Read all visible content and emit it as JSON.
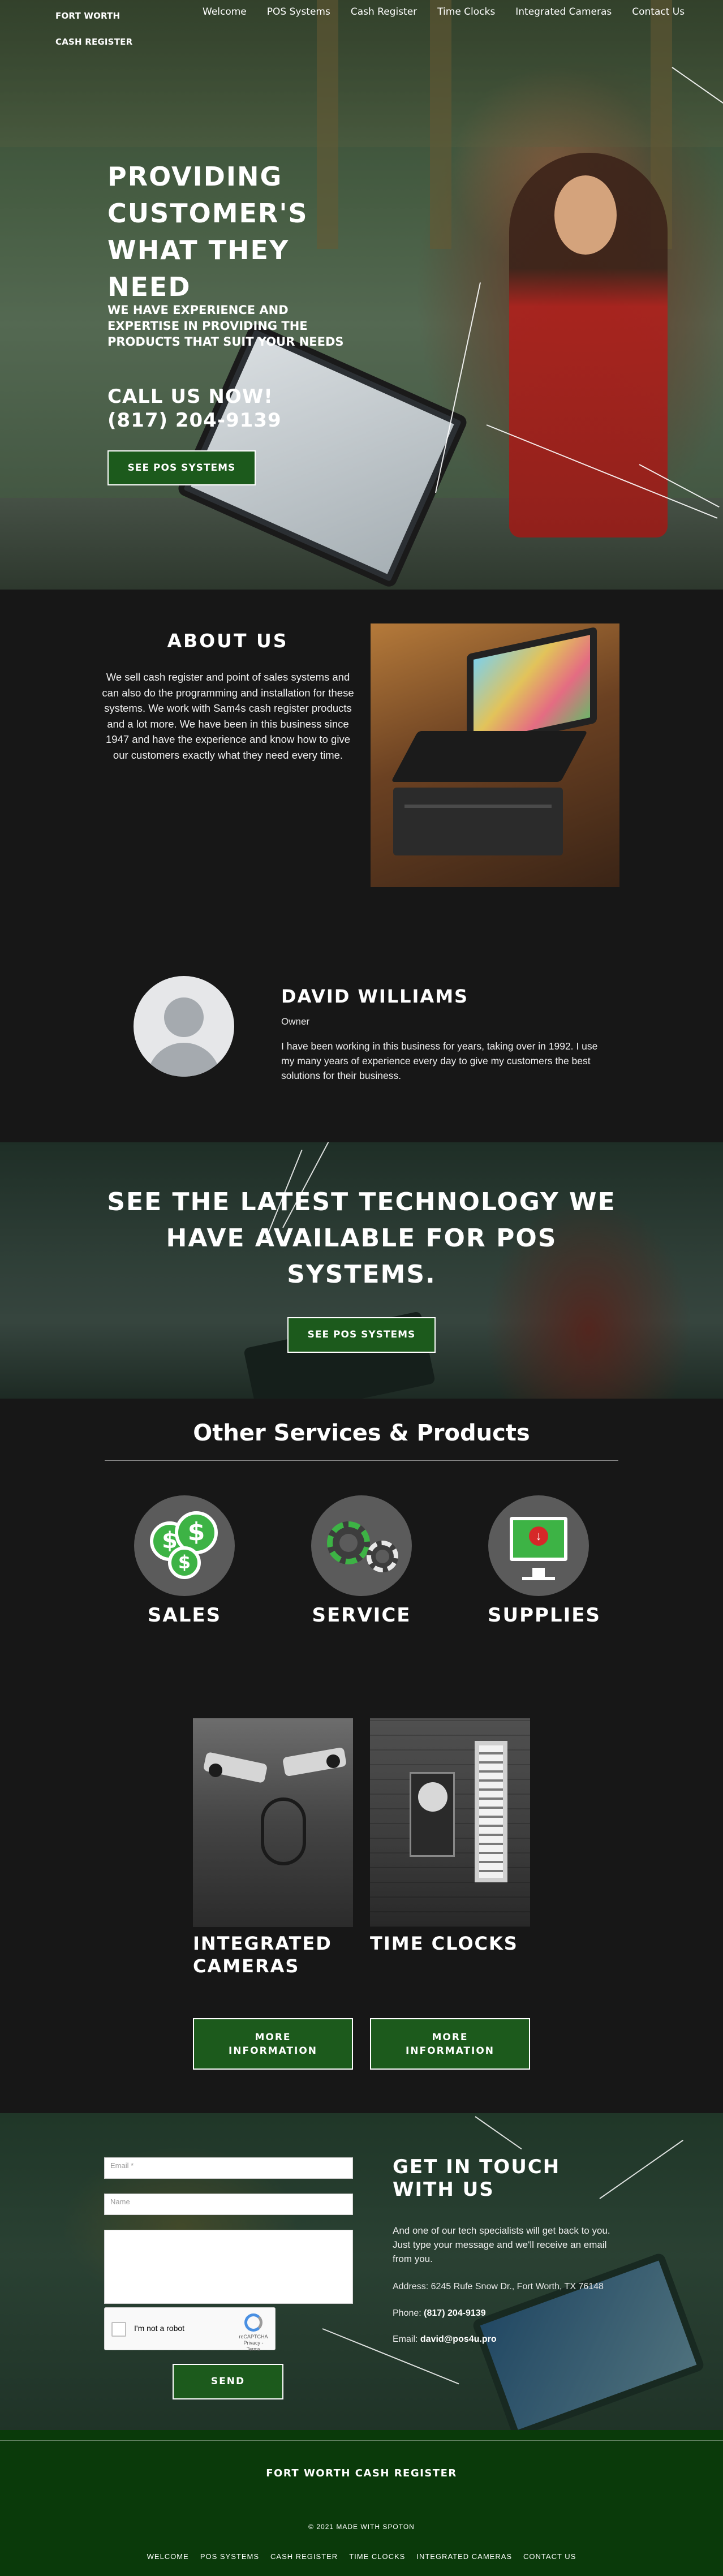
{
  "header": {
    "brand_line1": "FORT WORTH",
    "brand_line2": "CASH REGISTER",
    "nav": [
      "Welcome",
      "POS Systems",
      "Cash Register",
      "Time Clocks",
      "Integrated Cameras",
      "Contact Us"
    ]
  },
  "hero": {
    "title": "PROVIDING CUSTOMER'S WHAT THEY NEED",
    "subtitle": "WE HAVE EXPERIENCE AND EXPERTISE IN PROVIDING THE PRODUCTS THAT SUIT YOUR NEEDS",
    "call_label": "CALL US NOW!",
    "phone": "(817) 204-9139",
    "button": "SEE POS SYSTEMS"
  },
  "about": {
    "title": "ABOUT US",
    "text": "We sell cash register and point of sales systems and can also do the programming and installation for these systems. We work with Sam4s cash register products and a lot more. We have been in this business since 1947 and have the experience and know how to give our customers exactly what they need every time."
  },
  "owner": {
    "name": "DAVID WILLIAMS",
    "role": "Owner",
    "bio": "I have been working in this business for years, taking over in 1992. I use my many years of experience every day to give my customers the best solutions for their business."
  },
  "tech_banner": {
    "title": "SEE THE LATEST TECHNOLOGY WE HAVE AVAILABLE FOR POS SYSTEMS.",
    "button": "SEE POS SYSTEMS"
  },
  "services": {
    "title": "Other Services & Products",
    "items": [
      {
        "label": "SALES",
        "icon": "money-coins-icon"
      },
      {
        "label": "SERVICE",
        "icon": "gears-icon"
      },
      {
        "label": "SUPPLIES",
        "icon": "computer-download-icon"
      }
    ]
  },
  "products": [
    {
      "title": "INTEGRATED CAMERAS",
      "button": "MORE INFORMATION"
    },
    {
      "title": "TIME CLOCKS",
      "button": "MORE INFORMATION"
    }
  ],
  "contact": {
    "email_placeholder": "Email *",
    "name_placeholder": "Name",
    "message_placeholder": "",
    "recaptcha_label": "I'm not a robot",
    "recaptcha_brand": "reCAPTCHA",
    "recaptcha_terms": "Privacy - Terms",
    "send": "SEND",
    "title": "GET IN TOUCH WITH US",
    "text": "And one of our tech specialists will get back to you. Just type your message and we'll receive an email from you.",
    "address_label": "Address:",
    "address": "6245 Rufe Snow Dr., Fort Worth, TX 76148",
    "phone_label": "Phone:",
    "phone": "(817) 204-9139",
    "email_label": "Email:",
    "email": "david@pos4u.pro"
  },
  "footer": {
    "brand": "FORT WORTH CASH REGISTER",
    "copyright": "© 2021 MADE WITH SPOTON",
    "nav": [
      "WELCOME",
      "POS SYSTEMS",
      "CASH REGISTER",
      "TIME CLOCKS",
      "INTEGRATED CAMERAS",
      "CONTACT US"
    ]
  },
  "colors": {
    "background": "#171717",
    "button_green": "#1c5a1c",
    "footer_green": "#0a3a0a",
    "icon_green": "#3db345",
    "icon_circle": "#5b5b5b"
  }
}
